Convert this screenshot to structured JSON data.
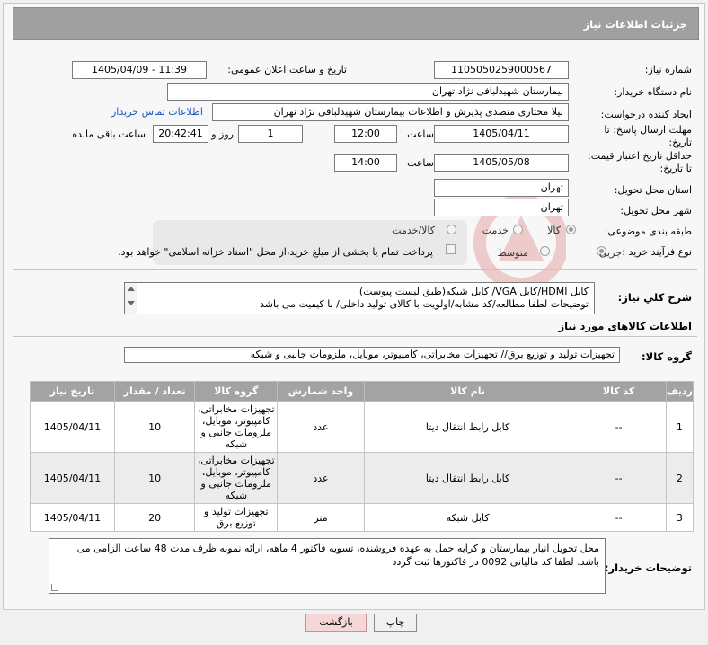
{
  "header": {
    "title": "جزئیات اطلاعات نیاز"
  },
  "fields": {
    "need_number_label": "شماره نیاز:",
    "need_number": "1105050259000567",
    "announce_label": "تاریخ و ساعت اعلان عمومی:",
    "announce_value": "1405/04/09 - 11:39",
    "buyer_org_label": "نام دستگاه خریدار:",
    "buyer_org": "بیمارستان شهیدلبافی نژاد تهران",
    "creator_label": "ایجاد کننده درخواست:",
    "creator": "لیلا مختاری متصدی پذیرش و اطلاعات بیمارستان شهیدلبافی نژاد تهران",
    "contact_link": "اطلاعات تماس خریدار",
    "deadline_label_1": "مهلت ارسال پاسخ: تا",
    "deadline_label_2": "تاریخ:",
    "deadline_date": "1405/04/11",
    "time_label": "ساعت",
    "deadline_time": "12:00",
    "day_value": "1",
    "day_label": "روز و",
    "remaining_time": "20:42:41",
    "remaining_label": "ساعت باقی مانده",
    "validity_label_1": "حداقل تاریخ اعتبار قیمت:",
    "validity_label_2": "تا تاریخ:",
    "validity_date": "1405/05/08",
    "validity_time": "14:00",
    "province_label": "استان محل تحویل:",
    "province": "تهران",
    "city_label": "شهر محل تحویل:",
    "city": "تهران",
    "category_label": "طبقه بندی موضوعی:",
    "category_options": [
      "کالا",
      "خدمت",
      "کالا/خدمت"
    ],
    "category_selected": "کالا",
    "process_label": "نوع فرآیند خرید :",
    "process_options": [
      "جزیی",
      "متوسط"
    ],
    "process_selected": "جزیی",
    "payment_note": "پرداخت تمام یا بخشی از مبلغ خرید،از محل \"اسناد خزانه اسلامی\" خواهد بود."
  },
  "description": {
    "label": "شرح کلي نياز:",
    "line1": "کابل HDMI/کابل VGA/ کابل شبکه(طبق لیست پیوست)",
    "line2": "توضیحات لطفا مطالعه/کد مشابه/اولویت با کالای تولید داخلی/ با کیفیت می باشد"
  },
  "goods_info": {
    "title": "اطلاعات کالاهای مورد نیاز",
    "group_label": "گروه کالا:",
    "group_value": "تجهیزات تولید و توزیع برق// تجهیزات مخابراتی، کامپیوتر، موبایل، ملزومات جانبی و شبکه"
  },
  "table": {
    "headers": [
      "ردیف",
      "کد کالا",
      "نام کالا",
      "واحد شمارش",
      "گروه کالا",
      "تعداد / مقدار",
      "تاریخ نیاز"
    ],
    "rows": [
      {
        "row": "1",
        "code": "--",
        "name": "کابل رابط انتقال دیتا",
        "unit": "عدد",
        "group": "تجهیزات مخابراتی، کامپیوتر، موبایل، ملزومات جانبی و شبکه",
        "qty": "10",
        "date": "1405/04/11"
      },
      {
        "row": "2",
        "code": "--",
        "name": "کابل رابط انتقال دیتا",
        "unit": "عدد",
        "group": "تجهیزات مخابراتی، کامپیوتر، موبایل، ملزومات جانبی و شبکه",
        "qty": "10",
        "date": "1405/04/11"
      },
      {
        "row": "3",
        "code": "--",
        "name": "کابل شبکه",
        "unit": "متر",
        "group": "تجهیزات تولید و توزیع برق",
        "qty": "20",
        "date": "1405/04/11"
      }
    ]
  },
  "buyer_notes": {
    "label": "توضیحات خریدار:",
    "text": "محل تحویل انبار بیمارستان و کرایه حمل به عهده فروشنده، تسویه فاکتور 4 ماهه، ارائه نمونه ظرف مدت 48 ساعت الزامی می باشد. لطفا کد مالیاتی 0092 در فاکتورها ثبت گردد"
  },
  "buttons": {
    "print": "چاپ",
    "back": "بازگشت"
  },
  "colors": {
    "header_bg": "#a0a0a0",
    "link": "#1a56c8",
    "back_btn": "#f6d7d7"
  }
}
